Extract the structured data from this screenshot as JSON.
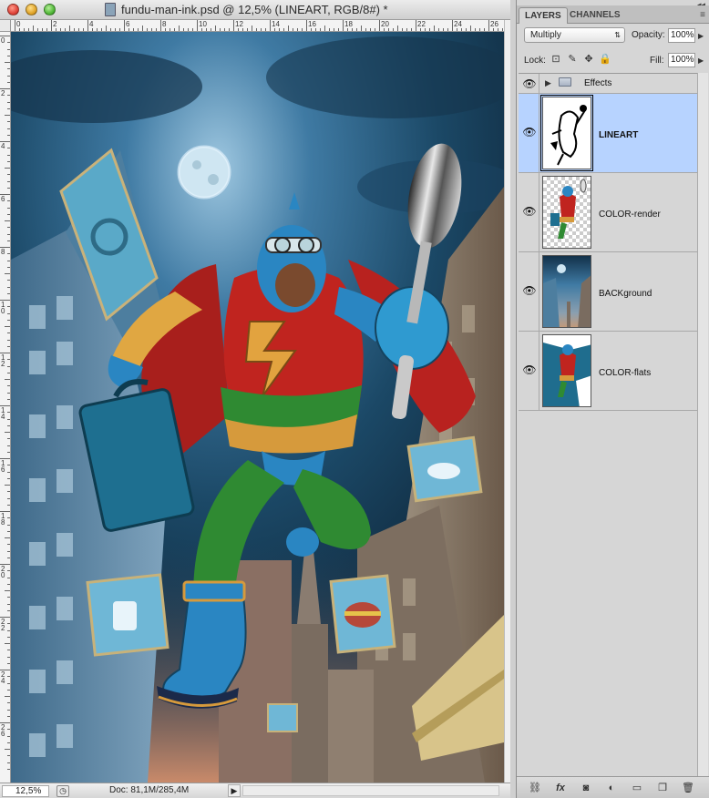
{
  "document": {
    "title": "fundu-man-ink.psd @ 12,5% (LINEART, RGB/8#) *",
    "zoom": "12,5%",
    "doc_info": "Doc: 81,1M/285,4M"
  },
  "rulers": {
    "horizontal_labels": [
      "0",
      "2",
      "4",
      "6",
      "8",
      "10",
      "12",
      "14",
      "16",
      "18",
      "20",
      "22",
      "24",
      "26"
    ],
    "vertical_labels": [
      "0",
      "2",
      "4",
      "6",
      "8",
      "1 0",
      "1 2",
      "1 4",
      "1 6",
      "1 8",
      "2 0",
      "2 2",
      "2 4",
      "2 6"
    ]
  },
  "panel": {
    "tabs": [
      "LAYERS",
      "CHANNELS"
    ],
    "active_tab": "LAYERS",
    "blend_mode": "Multiply",
    "opacity_label": "Opacity:",
    "opacity_value": "100%",
    "lock_label": "Lock:",
    "fill_label": "Fill:",
    "fill_value": "100%",
    "layers": [
      {
        "name": "Effects",
        "type": "group",
        "visible": true,
        "selected": false
      },
      {
        "name": "LINEART",
        "type": "layer",
        "visible": true,
        "selected": true
      },
      {
        "name": "COLOR-render",
        "type": "layer",
        "visible": true,
        "selected": false
      },
      {
        "name": "BACKground",
        "type": "layer",
        "visible": true,
        "selected": false
      },
      {
        "name": "COLOR-flats",
        "type": "layer",
        "visible": true,
        "selected": false
      }
    ],
    "footer_icons": [
      "link-icon",
      "fx-icon",
      "mask-icon",
      "adjustment-icon",
      "group-folder-icon",
      "new-layer-icon",
      "trash-icon"
    ]
  },
  "colors": {
    "selected_layer": "#b7d3ff",
    "sky_top": "#0f2a40",
    "sky_glow": "#3f7aa3",
    "hero_red": "#c0241f",
    "hero_blue": "#2a86c2",
    "hero_green": "#2f8a32",
    "hero_gold": "#e0a742"
  }
}
